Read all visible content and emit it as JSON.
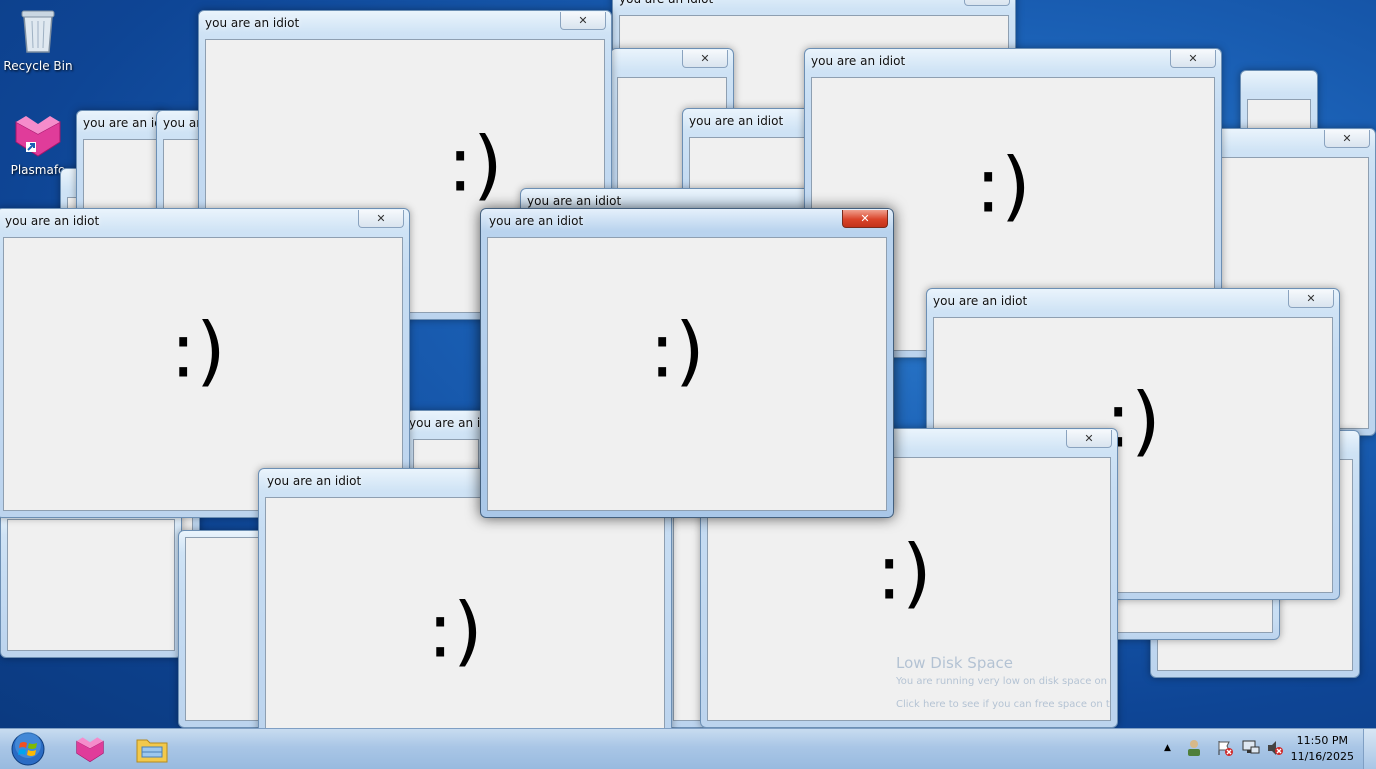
{
  "desktop": {
    "icons": [
      {
        "label": "Recycle Bin",
        "icon": "recycle-bin-icon"
      },
      {
        "label": "Plasmafo",
        "icon": "plasma-app-icon"
      }
    ]
  },
  "windows": {
    "title": "you are an idiot",
    "content": ":)",
    "close_glyph": "✕"
  },
  "notification": {
    "title": "Low Disk Space",
    "line1": "You are running very low on disk space on",
    "line2": "Click here to see if you can free space on this drive."
  },
  "taskbar": {
    "start_icon": "windows-orb-icon",
    "pinned": [
      {
        "name": "plasma-app-icon"
      },
      {
        "name": "file-explorer-icon"
      }
    ],
    "tray": {
      "show_hidden": "▲",
      "icons": [
        "user-tray-icon",
        "action-center-flag-icon",
        "network-icon",
        "volume-muted-icon"
      ]
    },
    "clock": {
      "time": "11:50 PM",
      "date": "11/16/2025"
    }
  },
  "colors": {
    "accent": "#1a5fb4",
    "close_active": "#c8432b"
  }
}
